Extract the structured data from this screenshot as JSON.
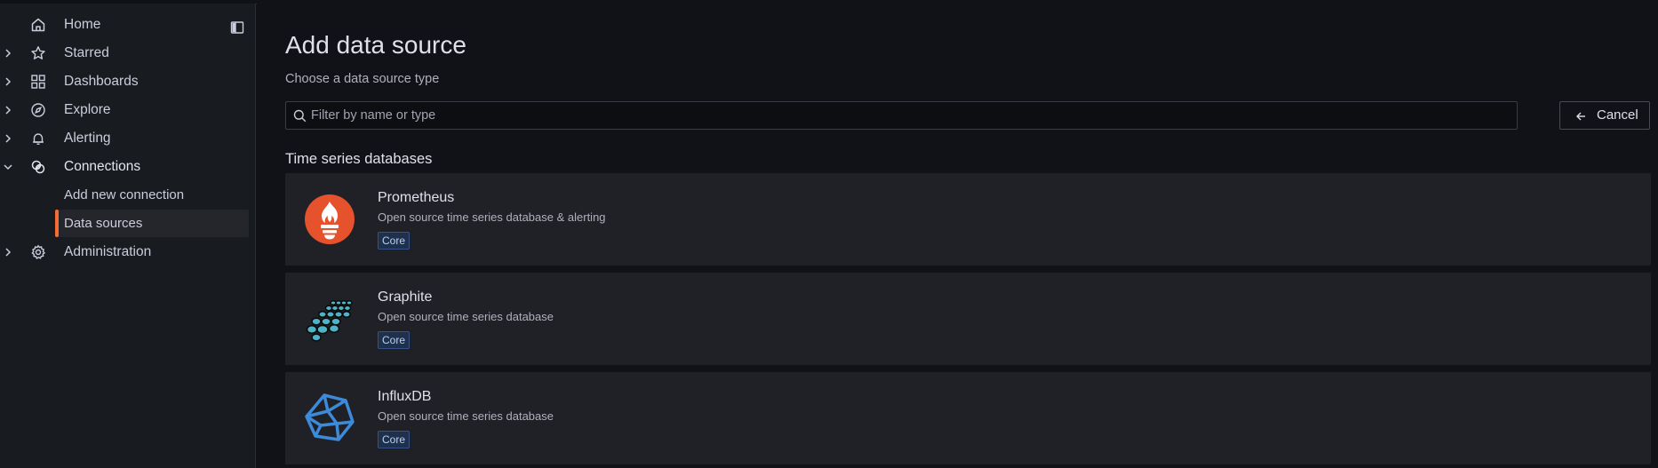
{
  "sidebar": {
    "items": [
      {
        "label": "Home",
        "icon": "home-icon",
        "expandable": false
      },
      {
        "label": "Starred",
        "icon": "star-icon",
        "expandable": true
      },
      {
        "label": "Dashboards",
        "icon": "dashboards-icon",
        "expandable": true
      },
      {
        "label": "Explore",
        "icon": "compass-icon",
        "expandable": true
      },
      {
        "label": "Alerting",
        "icon": "bell-icon",
        "expandable": true
      },
      {
        "label": "Connections",
        "icon": "connections-icon",
        "expandable": true,
        "expanded": true
      },
      {
        "label": "Administration",
        "icon": "gear-icon",
        "expandable": true
      }
    ],
    "connections_children": [
      {
        "label": "Add new connection",
        "selected": false
      },
      {
        "label": "Data sources",
        "selected": true
      }
    ],
    "dock_icon": "dock-menu-icon"
  },
  "main": {
    "title": "Add data source",
    "subtitle": "Choose a data source type",
    "search": {
      "placeholder": "Filter by name or type",
      "value": ""
    },
    "cancel_label": "Cancel",
    "section_title": "Time series databases",
    "datasources": [
      {
        "name": "Prometheus",
        "description": "Open source time series database & alerting",
        "badge": "Core",
        "logo": "prometheus-logo"
      },
      {
        "name": "Graphite",
        "description": "Open source time series database",
        "badge": "Core",
        "logo": "graphite-logo"
      },
      {
        "name": "InfluxDB",
        "description": "Open source time series database",
        "badge": "Core",
        "logo": "influxdb-logo"
      }
    ]
  },
  "colors": {
    "accent": "#f46d33",
    "badge_bg": "#1f304d",
    "card_bg": "#1f2127",
    "page_bg": "#111217",
    "sidebar_bg": "#181b1f"
  }
}
